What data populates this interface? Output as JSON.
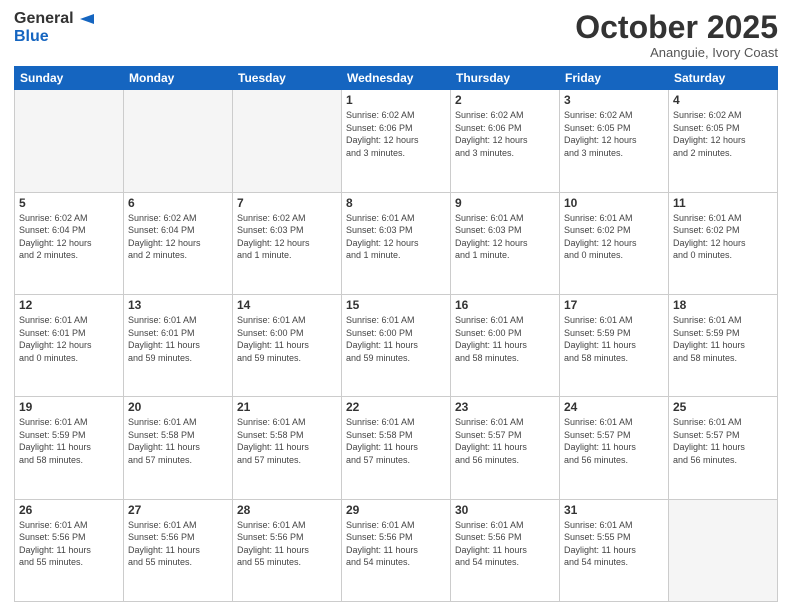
{
  "header": {
    "logo_general": "General",
    "logo_blue": "Blue",
    "month_title": "October 2025",
    "location": "Ananguie, Ivory Coast"
  },
  "weekdays": [
    "Sunday",
    "Monday",
    "Tuesday",
    "Wednesday",
    "Thursday",
    "Friday",
    "Saturday"
  ],
  "weeks": [
    [
      {
        "day": "",
        "info": ""
      },
      {
        "day": "",
        "info": ""
      },
      {
        "day": "",
        "info": ""
      },
      {
        "day": "1",
        "info": "Sunrise: 6:02 AM\nSunset: 6:06 PM\nDaylight: 12 hours\nand 3 minutes."
      },
      {
        "day": "2",
        "info": "Sunrise: 6:02 AM\nSunset: 6:06 PM\nDaylight: 12 hours\nand 3 minutes."
      },
      {
        "day": "3",
        "info": "Sunrise: 6:02 AM\nSunset: 6:05 PM\nDaylight: 12 hours\nand 3 minutes."
      },
      {
        "day": "4",
        "info": "Sunrise: 6:02 AM\nSunset: 6:05 PM\nDaylight: 12 hours\nand 2 minutes."
      }
    ],
    [
      {
        "day": "5",
        "info": "Sunrise: 6:02 AM\nSunset: 6:04 PM\nDaylight: 12 hours\nand 2 minutes."
      },
      {
        "day": "6",
        "info": "Sunrise: 6:02 AM\nSunset: 6:04 PM\nDaylight: 12 hours\nand 2 minutes."
      },
      {
        "day": "7",
        "info": "Sunrise: 6:02 AM\nSunset: 6:03 PM\nDaylight: 12 hours\nand 1 minute."
      },
      {
        "day": "8",
        "info": "Sunrise: 6:01 AM\nSunset: 6:03 PM\nDaylight: 12 hours\nand 1 minute."
      },
      {
        "day": "9",
        "info": "Sunrise: 6:01 AM\nSunset: 6:03 PM\nDaylight: 12 hours\nand 1 minute."
      },
      {
        "day": "10",
        "info": "Sunrise: 6:01 AM\nSunset: 6:02 PM\nDaylight: 12 hours\nand 0 minutes."
      },
      {
        "day": "11",
        "info": "Sunrise: 6:01 AM\nSunset: 6:02 PM\nDaylight: 12 hours\nand 0 minutes."
      }
    ],
    [
      {
        "day": "12",
        "info": "Sunrise: 6:01 AM\nSunset: 6:01 PM\nDaylight: 12 hours\nand 0 minutes."
      },
      {
        "day": "13",
        "info": "Sunrise: 6:01 AM\nSunset: 6:01 PM\nDaylight: 11 hours\nand 59 minutes."
      },
      {
        "day": "14",
        "info": "Sunrise: 6:01 AM\nSunset: 6:00 PM\nDaylight: 11 hours\nand 59 minutes."
      },
      {
        "day": "15",
        "info": "Sunrise: 6:01 AM\nSunset: 6:00 PM\nDaylight: 11 hours\nand 59 minutes."
      },
      {
        "day": "16",
        "info": "Sunrise: 6:01 AM\nSunset: 6:00 PM\nDaylight: 11 hours\nand 58 minutes."
      },
      {
        "day": "17",
        "info": "Sunrise: 6:01 AM\nSunset: 5:59 PM\nDaylight: 11 hours\nand 58 minutes."
      },
      {
        "day": "18",
        "info": "Sunrise: 6:01 AM\nSunset: 5:59 PM\nDaylight: 11 hours\nand 58 minutes."
      }
    ],
    [
      {
        "day": "19",
        "info": "Sunrise: 6:01 AM\nSunset: 5:59 PM\nDaylight: 11 hours\nand 58 minutes."
      },
      {
        "day": "20",
        "info": "Sunrise: 6:01 AM\nSunset: 5:58 PM\nDaylight: 11 hours\nand 57 minutes."
      },
      {
        "day": "21",
        "info": "Sunrise: 6:01 AM\nSunset: 5:58 PM\nDaylight: 11 hours\nand 57 minutes."
      },
      {
        "day": "22",
        "info": "Sunrise: 6:01 AM\nSunset: 5:58 PM\nDaylight: 11 hours\nand 57 minutes."
      },
      {
        "day": "23",
        "info": "Sunrise: 6:01 AM\nSunset: 5:57 PM\nDaylight: 11 hours\nand 56 minutes."
      },
      {
        "day": "24",
        "info": "Sunrise: 6:01 AM\nSunset: 5:57 PM\nDaylight: 11 hours\nand 56 minutes."
      },
      {
        "day": "25",
        "info": "Sunrise: 6:01 AM\nSunset: 5:57 PM\nDaylight: 11 hours\nand 56 minutes."
      }
    ],
    [
      {
        "day": "26",
        "info": "Sunrise: 6:01 AM\nSunset: 5:56 PM\nDaylight: 11 hours\nand 55 minutes."
      },
      {
        "day": "27",
        "info": "Sunrise: 6:01 AM\nSunset: 5:56 PM\nDaylight: 11 hours\nand 55 minutes."
      },
      {
        "day": "28",
        "info": "Sunrise: 6:01 AM\nSunset: 5:56 PM\nDaylight: 11 hours\nand 55 minutes."
      },
      {
        "day": "29",
        "info": "Sunrise: 6:01 AM\nSunset: 5:56 PM\nDaylight: 11 hours\nand 54 minutes."
      },
      {
        "day": "30",
        "info": "Sunrise: 6:01 AM\nSunset: 5:56 PM\nDaylight: 11 hours\nand 54 minutes."
      },
      {
        "day": "31",
        "info": "Sunrise: 6:01 AM\nSunset: 5:55 PM\nDaylight: 11 hours\nand 54 minutes."
      },
      {
        "day": "",
        "info": ""
      }
    ]
  ]
}
